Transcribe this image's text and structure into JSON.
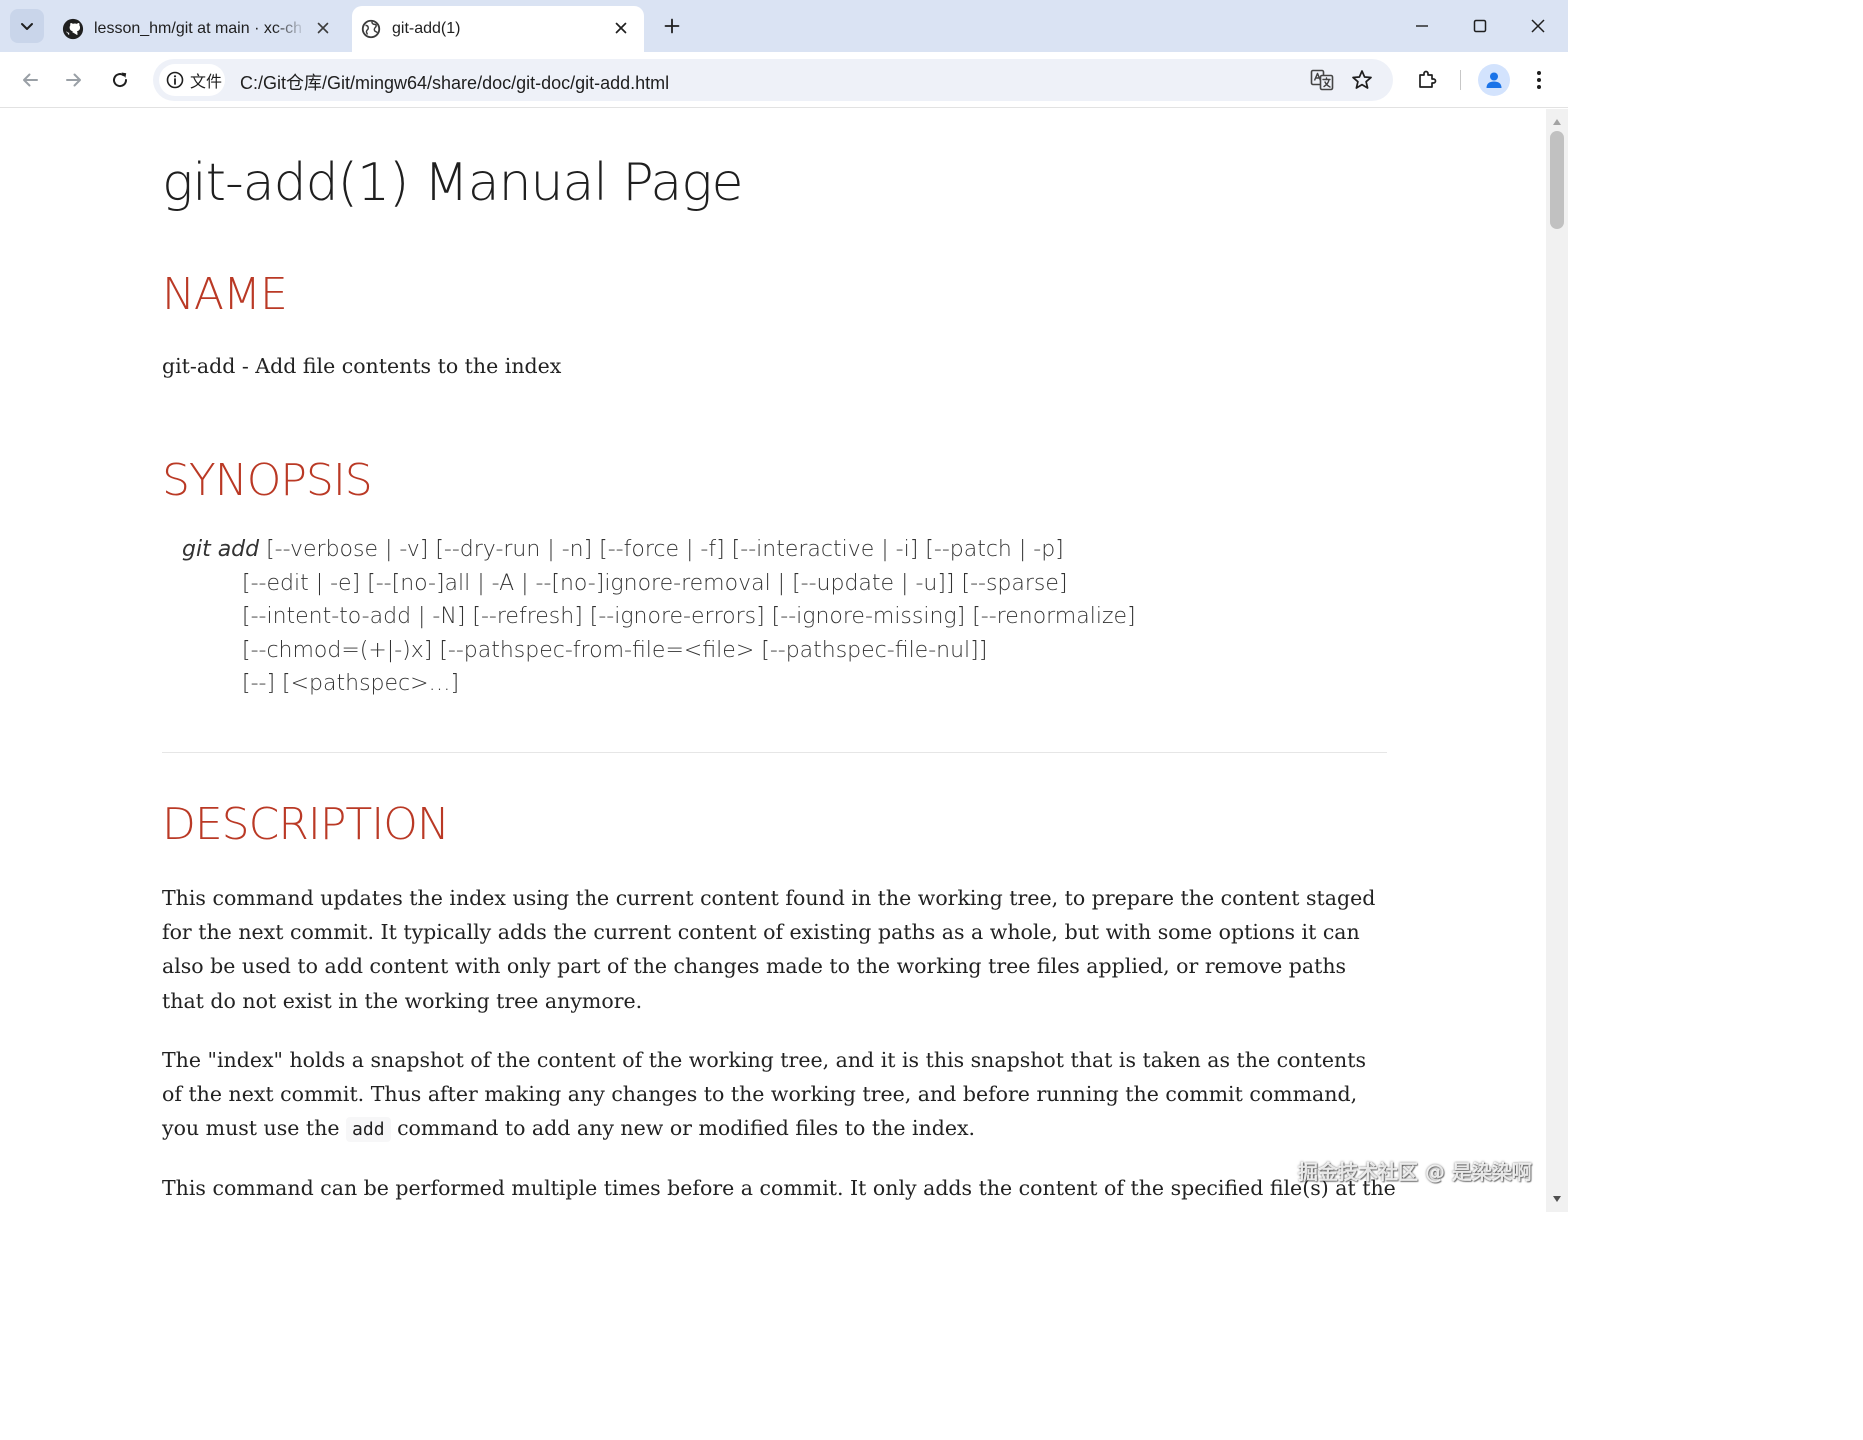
{
  "browser": {
    "tabs": [
      {
        "title": "lesson_hm/git at main · xc-ch",
        "favicon": "github-icon",
        "active": false
      },
      {
        "title": "git-add(1)",
        "favicon": "globe-icon",
        "active": true
      }
    ],
    "address_bar": {
      "security_chip_label": "文件",
      "url": "C:/Git仓库/Git/mingw64/share/doc/git-doc/git-add.html"
    }
  },
  "page": {
    "title": "git-add(1) Manual Page",
    "sections": {
      "name": {
        "heading": "NAME",
        "text": "git-add - Add file contents to the index"
      },
      "synopsis": {
        "heading": "SYNOPSIS",
        "command": "git add",
        "line1_rest": " [--verbose | -v] [--dry-run | -n] [--force | -f] [--interactive | -i] [--patch | -p]",
        "line2": "[--edit | -e] [--[no-]all | -A | --[no-]ignore-removal | [--update | -u]] [--sparse]",
        "line3": "[--intent-to-add | -N] [--refresh] [--ignore-errors] [--ignore-missing] [--renormalize]",
        "line4": "[--chmod=(+|-)x] [--pathspec-from-file=<file> [--pathspec-file-nul]]",
        "line5": "[--] [<pathspec>…​]"
      },
      "description": {
        "heading": "DESCRIPTION",
        "p1": "This command updates the index using the current content found in the working tree, to prepare the content staged for the next commit. It typically adds the current content of existing paths as a whole, but with some options it can also be used to add content with only part of the changes made to the working tree files applied, or remove paths that do not exist in the working tree anymore.",
        "p2_before": "The \"index\" holds a snapshot of the content of the working tree, and it is this snapshot that is taken as the contents of the next commit. Thus after making any changes to the working tree, and before running the commit command, you must use the ",
        "p2_code": "add",
        "p2_after": " command to add any new or modified files to the index.",
        "p3": "This command can be performed multiple times before a commit. It only adds the content of the specified file(s) at the"
      }
    }
  },
  "watermark": "掘金技术社区 @ 是染染啊",
  "colors": {
    "tabstrip": "#dae3f3",
    "heading_red": "#ba3925",
    "body_text": "#222222",
    "profile_blue": "#1a73e8"
  }
}
